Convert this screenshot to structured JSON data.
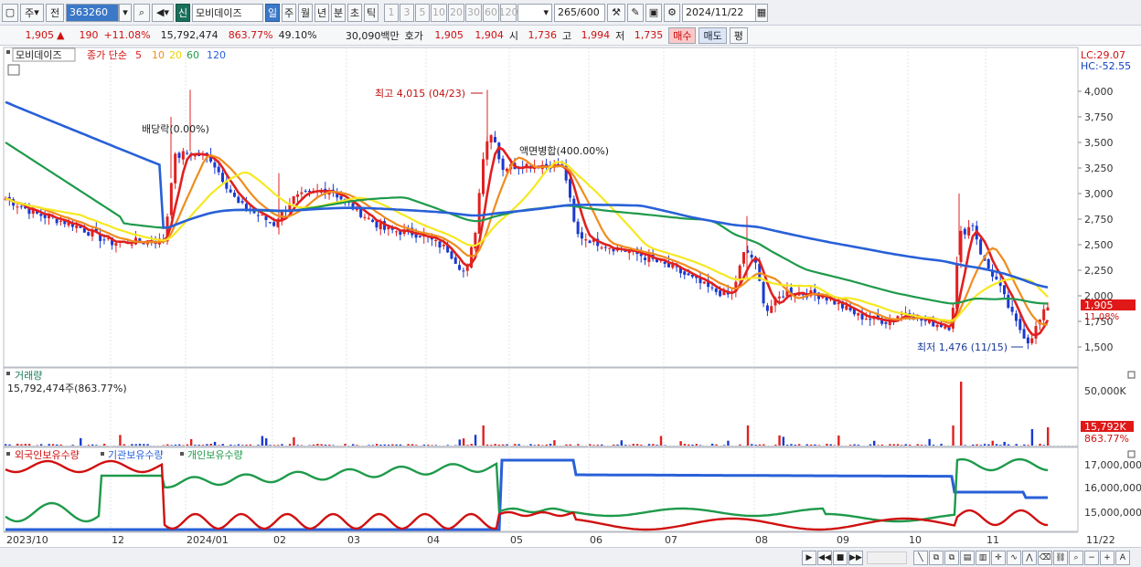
{
  "toolbar": {
    "period": "주",
    "view": "전",
    "code": "363260",
    "name": "모비데이즈",
    "badge": "신",
    "tabs": [
      "일",
      "주",
      "월",
      "년",
      "분",
      "초",
      "틱"
    ],
    "active_tab": "일",
    "ticks": [
      "1",
      "3",
      "5",
      "10",
      "20",
      "30",
      "60",
      "120"
    ],
    "count": "265",
    "count_total": "/600",
    "date": "2024/11/22"
  },
  "quote": {
    "price": "1,905",
    "arrow": "▲",
    "change": "190",
    "change_pct": "+11.08%",
    "volume": "15,792,474",
    "volume_ratio": "863.77%",
    "turnover": "49.10%",
    "amount": "30,090백만",
    "ask_label": "호가",
    "ask": "1,905",
    "bid": "1,904",
    "open_label": "시",
    "open": "1,736",
    "high_label": "고",
    "high": "1,994",
    "low_label": "저",
    "low": "1,735",
    "buy": "매수",
    "sell": "매도",
    "eval": "평"
  },
  "price_panel": {
    "name": "모비데이즈",
    "legend_label": "종가 단순",
    "ma": [
      {
        "period": "5",
        "color": "#e02020"
      },
      {
        "period": "10",
        "color": "#f08c1e"
      },
      {
        "period": "20",
        "color": "#f0e41e"
      },
      {
        "period": "60",
        "color": "#1e9a4a"
      },
      {
        "period": "120",
        "color": "#2860d8"
      }
    ],
    "lc": "LC:29.07",
    "hc": "HC:-52.55",
    "y_ticks": [
      "4,000",
      "3,750",
      "3,500",
      "3,250",
      "3,000",
      "2,750",
      "2,500",
      "2,250",
      "2,000",
      "1,750",
      "1,500"
    ],
    "current_price": "1,905",
    "current_pct": "11.08%",
    "high_note": "최고 4,015 (04/23)",
    "low_note": "최저 1,476 (11/15)",
    "dividend_note": "배당락(0.00%)",
    "split_note": "액면병합(400.00%)"
  },
  "volume_panel": {
    "title": "거래량",
    "info": "15,792,474주(863.77%)",
    "y_tick": "50,000K",
    "current": "15,792K",
    "current_pct": "863.77%"
  },
  "holdings_panel": {
    "series": [
      {
        "name": "외국인보유수량",
        "color": "#d01010"
      },
      {
        "name": "기관보유수량",
        "color": "#2860d8"
      },
      {
        "name": "개인보유수량",
        "color": "#1e9a4a"
      }
    ],
    "y_ticks": [
      "17,000,000",
      "16,000,000",
      "15,000,000"
    ]
  },
  "x_labels": [
    "2023/10",
    "12",
    "2024/01",
    "02",
    "03",
    "04",
    "05",
    "06",
    "07",
    "08",
    "09",
    "10",
    "11",
    "11/22"
  ]
}
